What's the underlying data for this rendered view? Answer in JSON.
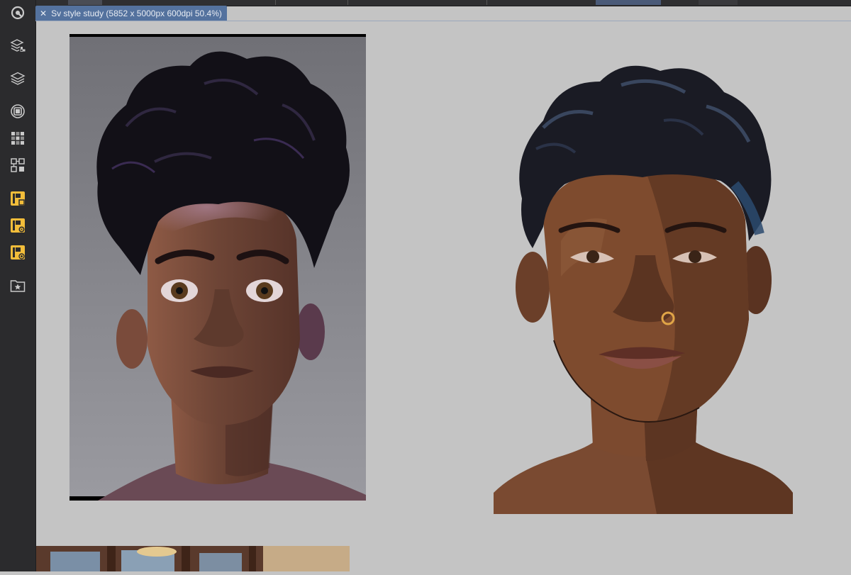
{
  "document_tab": {
    "title": "Sv style study (5852 x 5000px 600dpi 50.4%)",
    "close_glyph": "✕"
  },
  "sidebar": {
    "tools": [
      {
        "name": "app-logo-icon"
      },
      {
        "name": "layer-properties-icon"
      },
      {
        "name": "layers-icon"
      },
      {
        "name": "navigator-icon"
      },
      {
        "name": "color-set-icon"
      },
      {
        "name": "sub-tool-icon"
      },
      {
        "name": "plugin-icon",
        "accent": "#f2bd3a"
      },
      {
        "name": "plugin-settings-icon",
        "accent": "#f2bd3a"
      },
      {
        "name": "plugin-target-icon",
        "accent": "#f2bd3a"
      },
      {
        "name": "materials-icon"
      }
    ]
  },
  "colors": {
    "canvas_bg": "#c4c4c4",
    "sidebar_bg": "#2b2b2d",
    "tab_bg": "#54729e",
    "tool_accent": "#f2bd3a"
  }
}
